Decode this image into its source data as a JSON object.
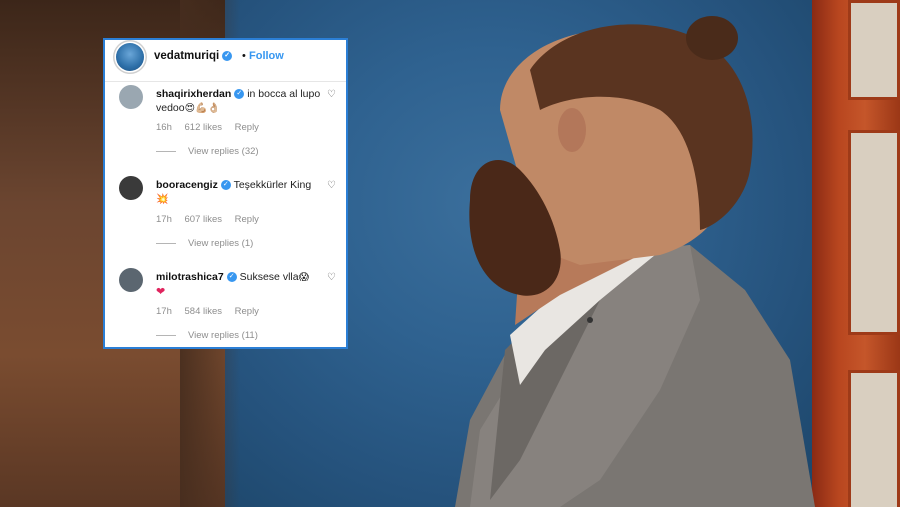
{
  "post": {
    "username": "vedatmuriqi",
    "verified_glyph": "✓",
    "separator": "•",
    "follow_label": "Follow"
  },
  "comments": [
    {
      "username": "shaqirixherdan",
      "text": "in bocca al lupo vedoo",
      "emoji": "😍💪🏼👌🏼",
      "time": "16h",
      "likes": "612 likes",
      "reply": "Reply",
      "view_replies": "View replies (32)",
      "avatar_color": "#9aa7b1"
    },
    {
      "username": "booracengiz",
      "text": "Teşekkürler King",
      "emoji": "💥",
      "time": "17h",
      "likes": "607 likes",
      "reply": "Reply",
      "view_replies": "View replies (1)",
      "avatar_color": "#3a3a3a"
    },
    {
      "username": "milotrashica7",
      "text": "Suksese vlla",
      "emoji": "😱",
      "emoji2": "❤",
      "time": "17h",
      "likes": "584 likes",
      "reply": "Reply",
      "view_replies": "View replies (11)",
      "avatar_color": "#5b6670"
    }
  ],
  "icons": {
    "heart": "heart-outline-icon"
  },
  "colors": {
    "card_border": "#2b7fd6",
    "follow": "#3897f0",
    "muted": "#8e8e8e"
  }
}
